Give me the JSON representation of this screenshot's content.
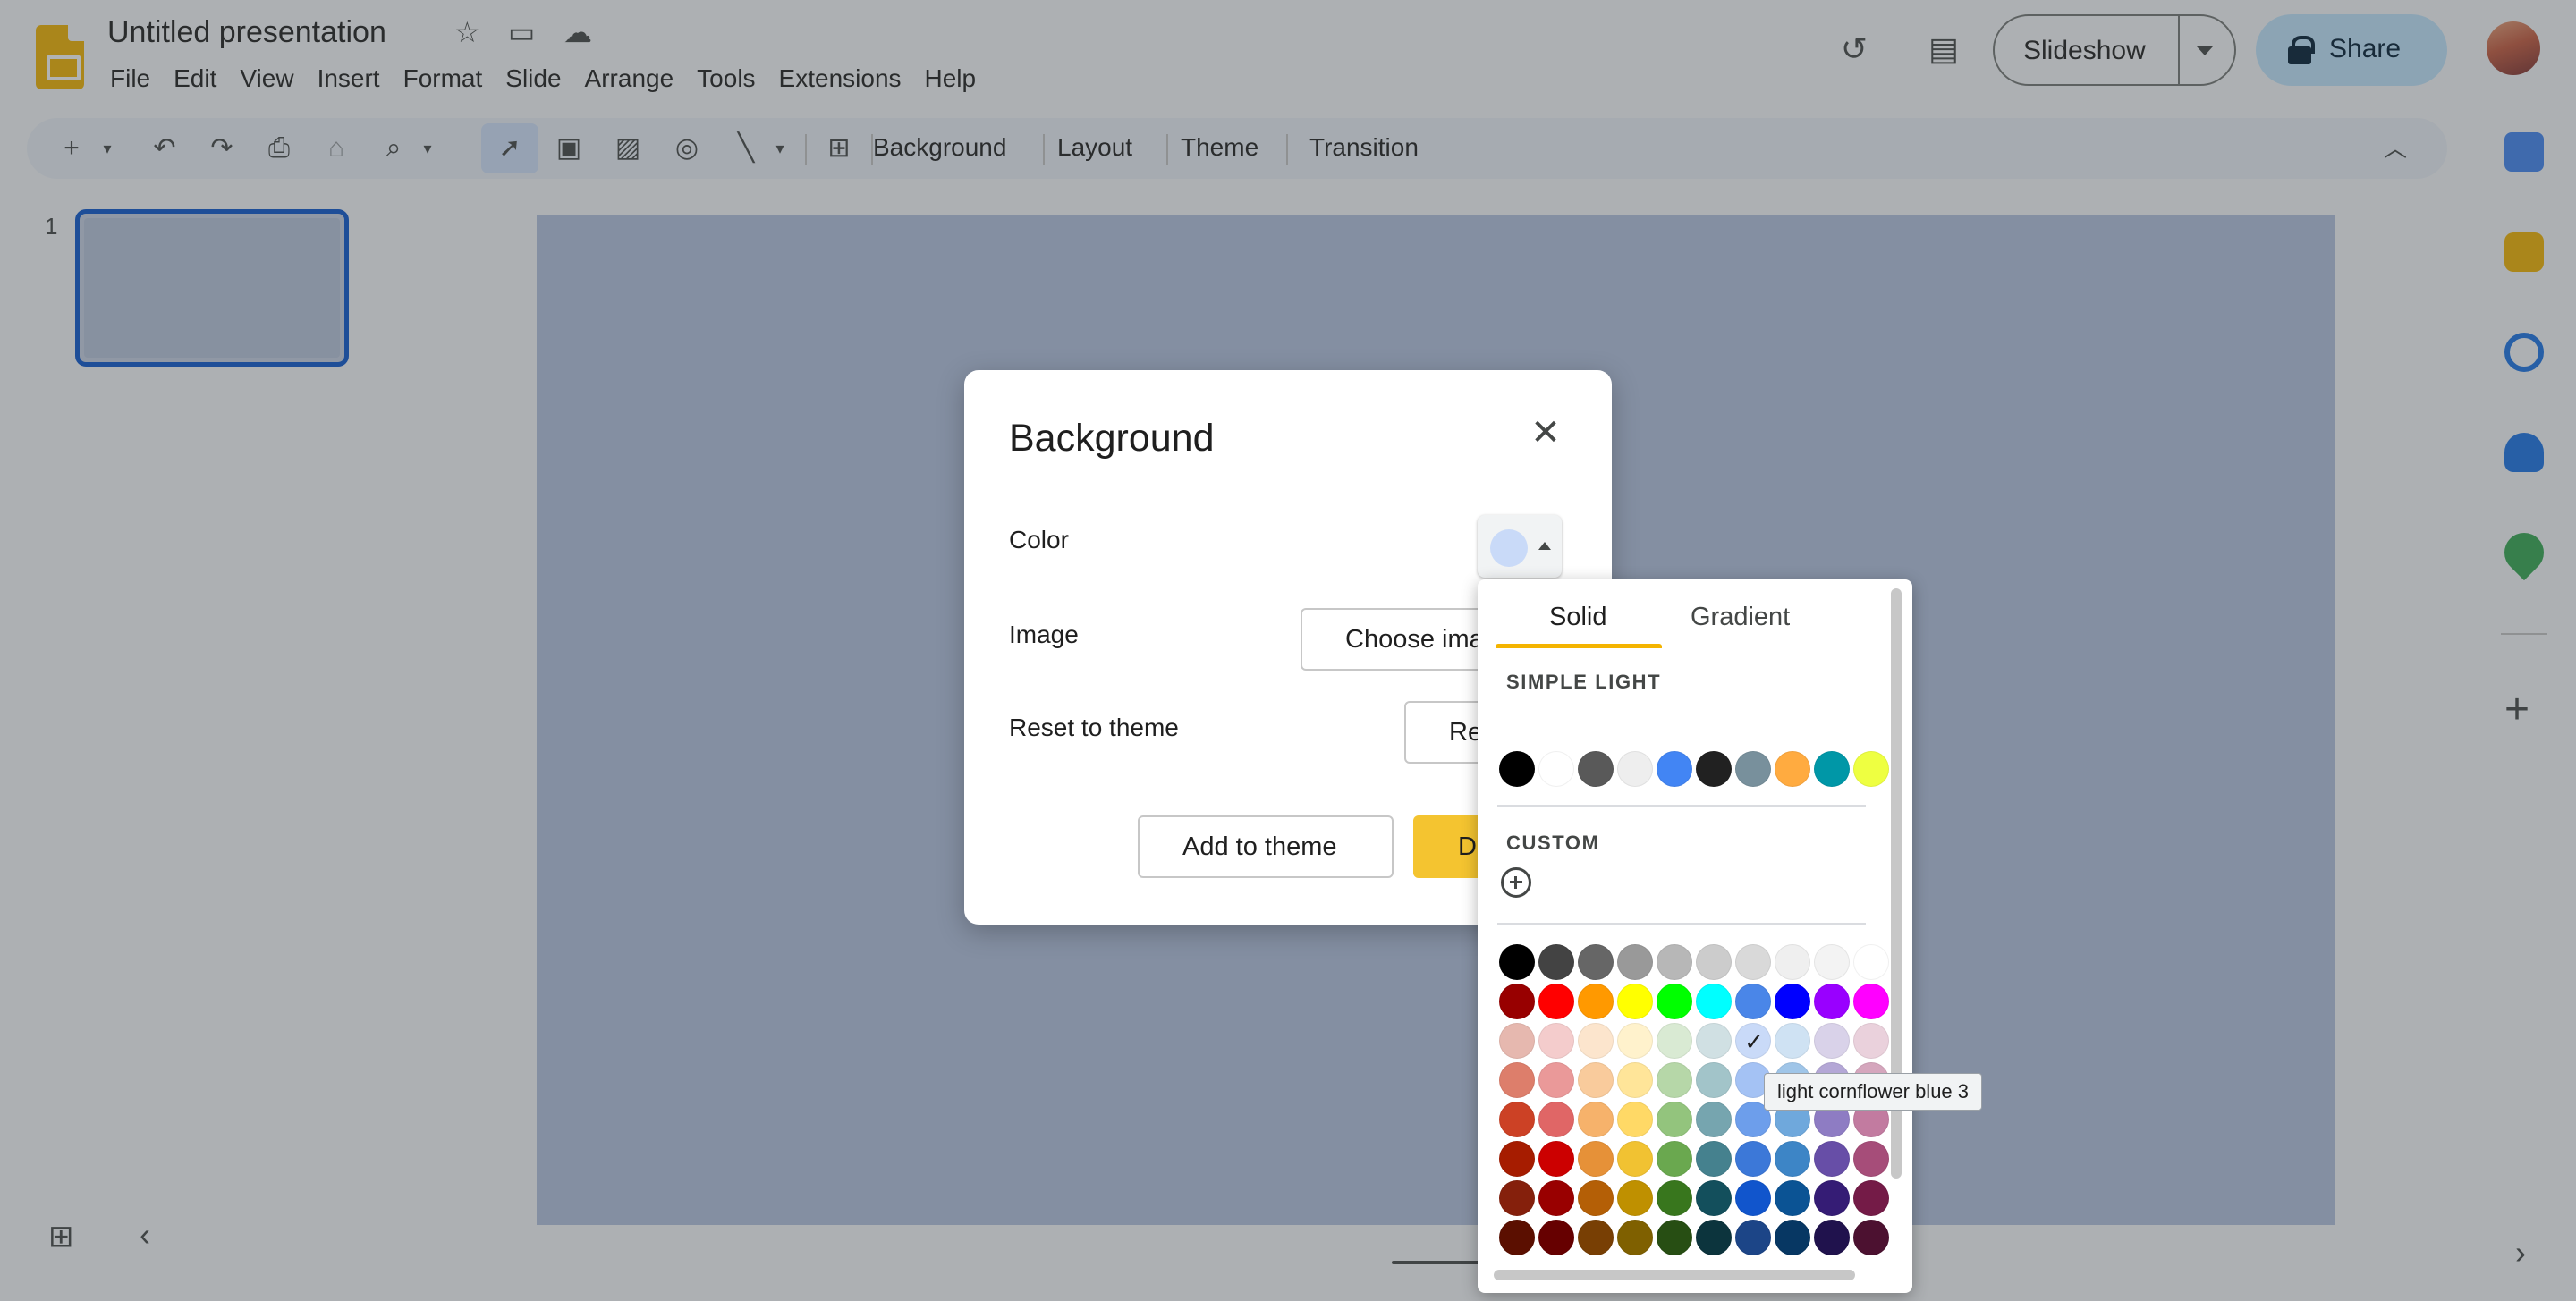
{
  "header": {
    "title": "Untitled presentation",
    "menu": [
      "File",
      "Edit",
      "View",
      "Insert",
      "Format",
      "Slide",
      "Arrange",
      "Tools",
      "Extensions",
      "Help"
    ],
    "slideshow_label": "Slideshow",
    "share_label": "Share"
  },
  "toolbar": {
    "background": "Background",
    "layout": "Layout",
    "theme": "Theme",
    "transition": "Transition"
  },
  "filmstrip": {
    "slide_number": "1"
  },
  "dialog": {
    "title": "Background",
    "color_label": "Color",
    "image_label": "Image",
    "reset_label": "Reset to theme",
    "choose_image_button": "Choose ima",
    "reset_button": "Re",
    "add_to_theme_button": "Add to theme",
    "done_button": "D",
    "selected_color": "#c9daf8"
  },
  "picker": {
    "tab_solid": "Solid",
    "tab_gradient": "Gradient",
    "section_theme": "SIMPLE LIGHT",
    "section_custom": "CUSTOM",
    "theme_colors": [
      "#000000",
      "#ffffff",
      "#595959",
      "#eeeeee",
      "#4285f4",
      "#212121",
      "#78909c",
      "#ffab40",
      "#0097a7",
      "#eeff41"
    ],
    "palette": [
      [
        "#000000",
        "#434343",
        "#666666",
        "#999999",
        "#b7b7b7",
        "#cccccc",
        "#d9d9d9",
        "#efefef",
        "#f3f3f3",
        "#ffffff"
      ],
      [
        "#980000",
        "#ff0000",
        "#ff9900",
        "#ffff00",
        "#00ff00",
        "#00ffff",
        "#4a86e8",
        "#0000ff",
        "#9900ff",
        "#ff00ff"
      ],
      [
        "#e6b8af",
        "#f4cccc",
        "#fce5cd",
        "#fff2cc",
        "#d9ead3",
        "#d0e0e3",
        "#c9daf8",
        "#cfe2f3",
        "#d9d2e9",
        "#ead1dc"
      ],
      [
        "#dd7e6b",
        "#ea9999",
        "#f9cb9c",
        "#ffe599",
        "#b6d7a8",
        "#a2c4c9",
        "#a4c2f4",
        "#9fc5e8",
        "#b4a7d6",
        "#d5a6bd"
      ],
      [
        "#cc4125",
        "#e06666",
        "#f6b26b",
        "#ffd966",
        "#93c47d",
        "#76a5af",
        "#6d9eeb",
        "#6fa8dc",
        "#8e7cc3",
        "#c27ba0"
      ],
      [
        "#a61c00",
        "#cc0000",
        "#e69138",
        "#f1c232",
        "#6aa84f",
        "#45818e",
        "#3c78d8",
        "#3d85c6",
        "#674ea7",
        "#a64d79"
      ],
      [
        "#85200c",
        "#990000",
        "#b45f06",
        "#bf9000",
        "#38761d",
        "#134f5c",
        "#1155cc",
        "#0b5394",
        "#351c75",
        "#741b47"
      ],
      [
        "#5b0f00",
        "#660000",
        "#783f04",
        "#7f6000",
        "#274e13",
        "#0c343d",
        "#1c4587",
        "#073763",
        "#20124d",
        "#4c1130"
      ]
    ],
    "selected": {
      "row": 2,
      "col": 6
    },
    "tooltip": "light cornflower blue 3"
  }
}
